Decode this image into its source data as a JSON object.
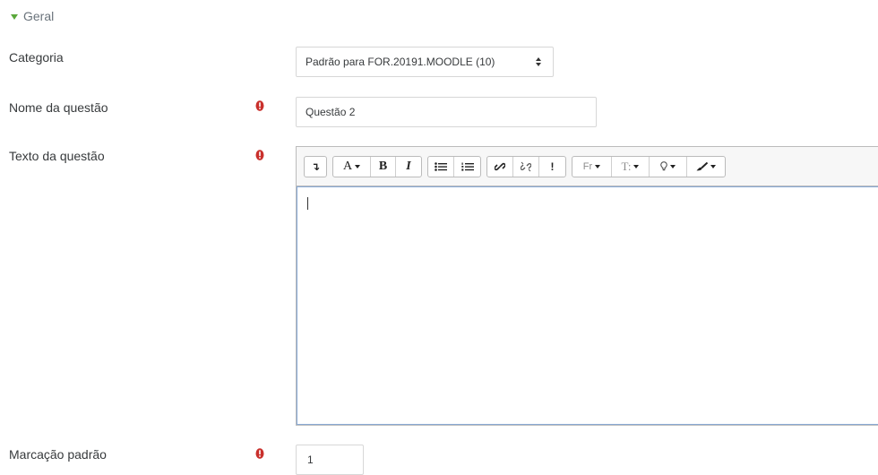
{
  "section": {
    "title": "Geral"
  },
  "form": {
    "category": {
      "label": "Categoria",
      "value": "Padrão para FOR.20191.MOODLE (10)"
    },
    "question_name": {
      "label": "Nome da questão",
      "value": "Questão 2"
    },
    "question_text": {
      "label": "Texto da questão"
    },
    "default_mark": {
      "label": "Marcação padrão",
      "value": "1"
    }
  },
  "toolbar": {
    "toggle": "↴",
    "font_color": "A",
    "bold": "B",
    "italic": "I",
    "equation": "!",
    "font_family": "Fr",
    "font_size": "T:"
  },
  "colors": {
    "required": "#c9302c",
    "triangle": "#5aa83a",
    "border": "#d7d7d7",
    "focus": "#8aabd6"
  }
}
